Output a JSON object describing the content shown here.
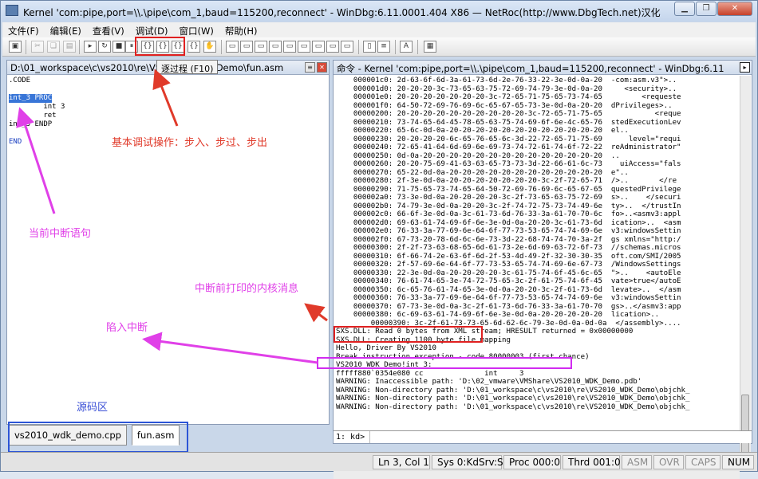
{
  "window": {
    "title": "Kernel 'com:pipe,port=\\\\.\\pipe\\com_1,baud=115200,reconnect' - WinDbg:6.11.0001.404 X86 — NetRoc(http://www.DbgTech.net)汉化",
    "buttons": [
      "▁",
      "❐",
      "✕"
    ]
  },
  "menu": [
    "文件(F)",
    "编辑(E)",
    "查看(V)",
    "调试(D)",
    "窗口(W)",
    "帮助(H)"
  ],
  "toolbar": {
    "tooltip": "逐过程 (F10)",
    "step_into": "{}",
    "step_over": "{}",
    "step_out": "{}"
  },
  "source_pane": {
    "title": "D:\\01_workspace\\c\\vs2010\\re\\VS2010_WDK_Demo\\fun.asm",
    "lines": [
      ".CODE",
      "",
      "int_3 PROC",
      "        int 3",
      "        ret",
      "int_3 ENDP",
      "",
      "END"
    ],
    "selected_line": "int_3 PROC",
    "end_line": "END",
    "tabs": [
      "vs2010_wdk_demo.cpp",
      "fun.asm"
    ]
  },
  "command_pane": {
    "title": "命令 - Kernel 'com:pipe,port=\\\\.\\pipe\\com_1,baud=115200,reconnect' - WinDbg:6.11",
    "dump_lines": [
      "    000001c0: 2d-63-6f-6d-3a-61-73-6d-2e-76-33-22-3e-0d-0a-20  -com:asm.v3\">.. ",
      "    000001d0: 20-20-20-3c-73-65-63-75-72-69-74-79-3e-0d-0a-20     <security>.. ",
      "    000001e0: 20-20-20-20-20-20-20-3c-72-65-71-75-65-73-74-65         <requeste",
      "    000001f0: 64-50-72-69-76-69-6c-65-67-65-73-3e-0d-0a-20-20  dPrivileges>..  ",
      "    00000200: 20-20-20-20-20-20-20-20-20-20-3c-72-65-71-75-65            <reque",
      "    00000210: 73-74-65-64-45-78-65-63-75-74-69-6f-6e-4c-65-76  stedExecutionLev",
      "    00000220: 65-6c-0d-0a-20-20-20-20-20-20-20-20-20-20-20-20  el..            ",
      "    00000230: 20-20-20-20-6c-65-76-65-6c-3d-22-72-65-71-75-69      level=\"requi",
      "    00000240: 72-65-41-64-6d-69-6e-69-73-74-72-61-74-6f-72-22  reAdministrator\"",
      "    00000250: 0d-0a-20-20-20-20-20-20-20-20-20-20-20-20-20-20  ..              ",
      "    00000260: 20-20-75-69-41-63-63-65-73-73-3d-22-66-61-6c-73    uiAccess=\"fals",
      "    00000270: 65-22-0d-0a-20-20-20-20-20-20-20-20-20-20-20-20  e\"..            ",
      "    00000280: 2f-3e-0d-0a-20-20-20-20-20-20-20-3c-2f-72-65-71  />..       </re",
      "    00000290: 71-75-65-73-74-65-64-50-72-69-76-69-6c-65-67-65  questedPrivilege",
      "    000002a0: 73-3e-0d-0a-20-20-20-20-3c-2f-73-65-63-75-72-69  s>..    </securi",
      "    000002b0: 74-79-3e-0d-0a-20-20-3c-2f-74-72-75-73-74-49-6e  ty>..  </trustIn",
      "    000002c0: 66-6f-3e-0d-0a-3c-61-73-6d-76-33-3a-61-70-70-6c  fo>..<asmv3:appl",
      "    000002d0: 69-63-61-74-69-6f-6e-3e-0d-0a-20-20-3c-61-73-6d  ication>..  <asm",
      "    000002e0: 76-33-3a-77-69-6e-64-6f-77-73-53-65-74-74-69-6e  v3:windowsSettin",
      "    000002f0: 67-73-20-78-6d-6c-6e-73-3d-22-68-74-74-70-3a-2f  gs xmlns=\"http:/",
      "    00000300: 2f-2f-73-63-68-65-6d-61-73-2e-6d-69-63-72-6f-73  //schemas.micros",
      "    00000310: 6f-66-74-2e-63-6f-6d-2f-53-4d-49-2f-32-30-30-35  oft.com/SMI/2005",
      "    00000320: 2f-57-69-6e-64-6f-77-73-53-65-74-74-69-6e-67-73  /WindowsSettings",
      "    00000330: 22-3e-0d-0a-20-20-20-20-3c-61-75-74-6f-45-6c-65  \">..    <autoEle",
      "    00000340: 76-61-74-65-3e-74-72-75-65-3c-2f-61-75-74-6f-45  vate>true</autoE",
      "    00000350: 6c-65-76-61-74-65-3e-0d-0a-20-20-3c-2f-61-73-6d  levate>..  </asm",
      "    00000360: 76-33-3a-77-69-6e-64-6f-77-73-53-65-74-74-69-6e  v3:windowsSettin",
      "    00000370: 67-73-3e-0d-0a-3c-2f-61-73-6d-76-33-3a-61-70-70  gs>..</asmv3:app",
      "    00000380: 6c-69-63-61-74-69-6f-6e-3e-0d-0a-20-20-20-20-20  lication>..     ",
      "        00000390: 3c-2f-61-73-73-65-6d-62-6c-79-3e-0d-0a-0d-0a  </assembly>...."
    ],
    "log_lines": [
      "SXS.DLL: Read 0 bytes from XML stream; HRESULT returned = 0x00000000",
      "SXS.DLL: Creating 1100 byte file mapping",
      "Hello, Driver By VS2010",
      "Break instruction exception - code 80000003 (first chance)",
      "VS2010_WDK_Demo!int_3:",
      "fffff880`0354e080 cc              int     3",
      "WARNING: Inaccessible path: 'D:\\02_vmware\\VMShare\\VS2010_WDK_Demo.pdb'",
      "WARNING: Non-directory path: 'D:\\01_workspace\\c\\vs2010\\re\\VS2010_WDK_Demo\\objchk_",
      "WARNING: Non-directory path: 'D:\\01_workspace\\c\\vs2010\\re\\VS2010_WDK_Demo\\objchk_",
      "WARNING: Non-directory path: 'D:\\01_workspace\\c\\vs2010\\re\\VS2010_WDK_Demo\\objchk_"
    ],
    "prompt": "1: kd>",
    "input_value": ""
  },
  "statusbar": {
    "position": "Ln 3, Col 1",
    "sys": "Sys 0:KdSrv:S",
    "proc": "Proc 000:0",
    "thrd": "Thrd 001:0",
    "asm": "ASM",
    "ovr": "OVR",
    "caps": "CAPS",
    "num": "NUM"
  },
  "annotations": {
    "debug_ops": "基本调试操作：步入、步过、步出",
    "current_break": "当前中断语句",
    "kernel_msg": "中断前打印的内核消息",
    "trap": "陷入中断",
    "source_area": "源码区"
  },
  "colors": {
    "red": "#e03a2a",
    "pink": "#e040e8",
    "blue": "#3a4fd6",
    "selection": "#3875d7"
  }
}
